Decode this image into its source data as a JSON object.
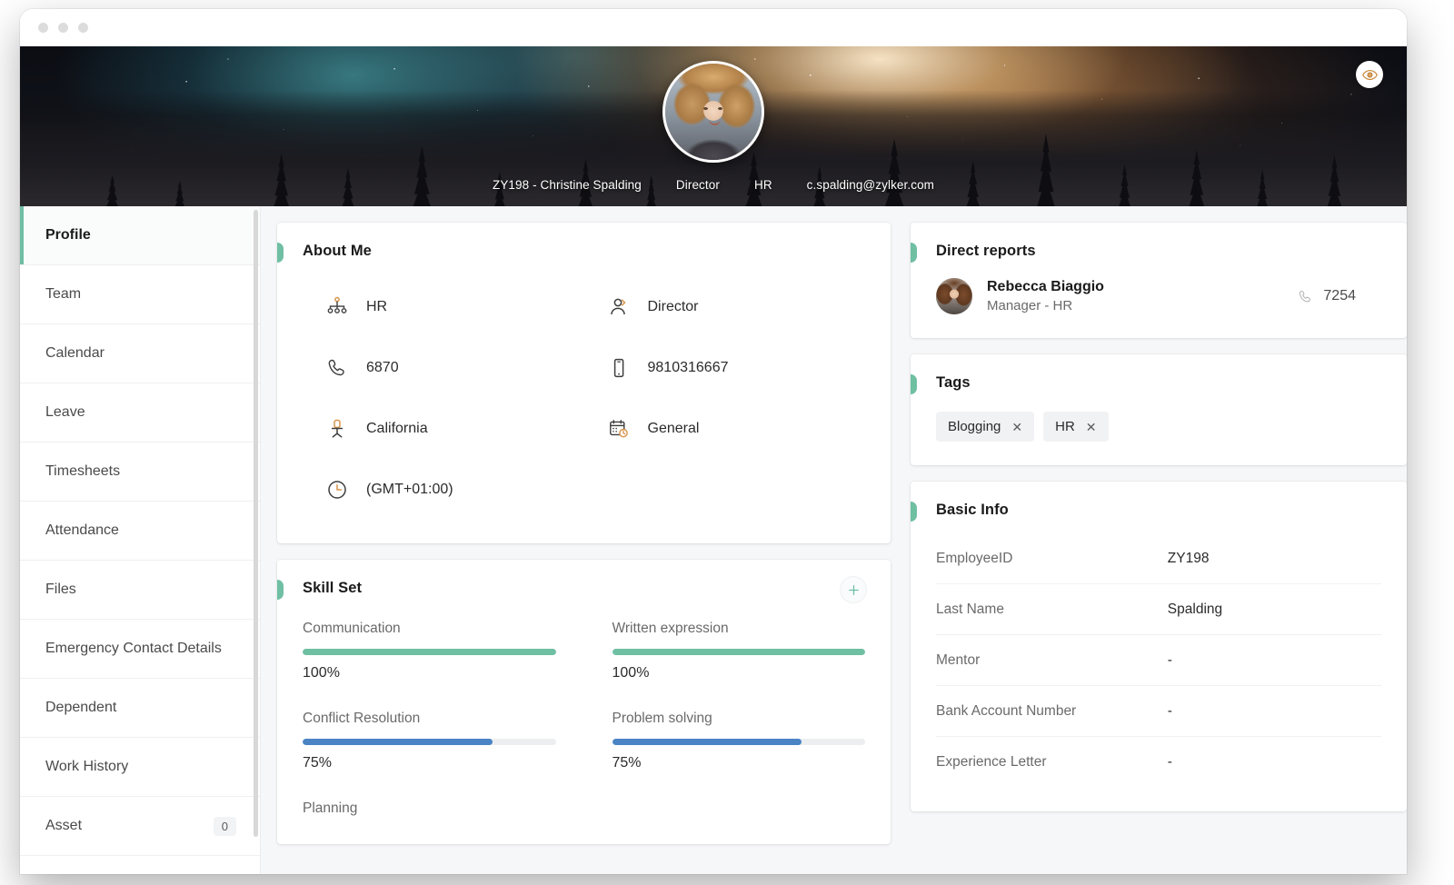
{
  "window": {
    "traffic_lights": [
      "close",
      "minimize",
      "zoom"
    ]
  },
  "banner": {
    "employee_line": "ZY198 - Christine Spalding",
    "designation": "Director",
    "department": "HR",
    "email": "c.spalding@zylker.com",
    "preview_icon": "eye-icon",
    "accent_color": "#6fbfa3"
  },
  "sidebar": {
    "items": [
      {
        "label": "Profile",
        "active": true,
        "badge": ""
      },
      {
        "label": "Team",
        "active": false,
        "badge": ""
      },
      {
        "label": "Calendar",
        "active": false,
        "badge": ""
      },
      {
        "label": "Leave",
        "active": false,
        "badge": ""
      },
      {
        "label": "Timesheets",
        "active": false,
        "badge": ""
      },
      {
        "label": "Attendance",
        "active": false,
        "badge": ""
      },
      {
        "label": "Files",
        "active": false,
        "badge": ""
      },
      {
        "label": "Emergency Contact Details",
        "active": false,
        "badge": ""
      },
      {
        "label": "Dependent",
        "active": false,
        "badge": ""
      },
      {
        "label": "Work History",
        "active": false,
        "badge": ""
      },
      {
        "label": "Asset",
        "active": false,
        "badge": "0"
      }
    ]
  },
  "about_me": {
    "title": "About Me",
    "items": [
      {
        "icon": "org-chart-icon",
        "value": "HR"
      },
      {
        "icon": "user-role-icon",
        "value": "Director"
      },
      {
        "icon": "phone-icon",
        "value": "6870"
      },
      {
        "icon": "mobile-icon",
        "value": "9810316667"
      },
      {
        "icon": "office-chair-icon",
        "value": "California"
      },
      {
        "icon": "calendar-clock-icon",
        "value": "General"
      },
      {
        "icon": "clock-icon",
        "value": "(GMT+01:00)"
      }
    ]
  },
  "skill_set": {
    "title": "Skill Set",
    "add_icon": "plus-icon",
    "skills": [
      {
        "name": "Communication",
        "percent": "100%",
        "value": 100,
        "color": "#6fbfa3"
      },
      {
        "name": "Written expression",
        "percent": "100%",
        "value": 100,
        "color": "#6fbfa3"
      },
      {
        "name": "Conflict Resolution",
        "percent": "75%",
        "value": 75,
        "color": "#4a84c4"
      },
      {
        "name": "Problem solving",
        "percent": "75%",
        "value": 75,
        "color": "#4a84c4"
      },
      {
        "name": "Planning",
        "percent": "",
        "value": 0,
        "color": "#4a84c4"
      }
    ]
  },
  "direct_reports": {
    "title": "Direct reports",
    "people": [
      {
        "name": "Rebecca Biaggio",
        "role": "Manager - HR",
        "phone": "7254",
        "phone_icon": "phone-icon",
        "avatar": "avatar"
      }
    ]
  },
  "tags": {
    "title": "Tags",
    "items": [
      {
        "label": "Blogging",
        "remove_icon": "close-icon"
      },
      {
        "label": "HR",
        "remove_icon": "close-icon"
      }
    ]
  },
  "basic_info": {
    "title": "Basic Info",
    "rows": [
      {
        "label": "EmployeeID",
        "value": "ZY198"
      },
      {
        "label": "Last Name",
        "value": "Spalding"
      },
      {
        "label": "Mentor",
        "value": "-"
      },
      {
        "label": "Bank Account Number",
        "value": "-"
      },
      {
        "label": "Experience Letter",
        "value": "-"
      }
    ]
  }
}
